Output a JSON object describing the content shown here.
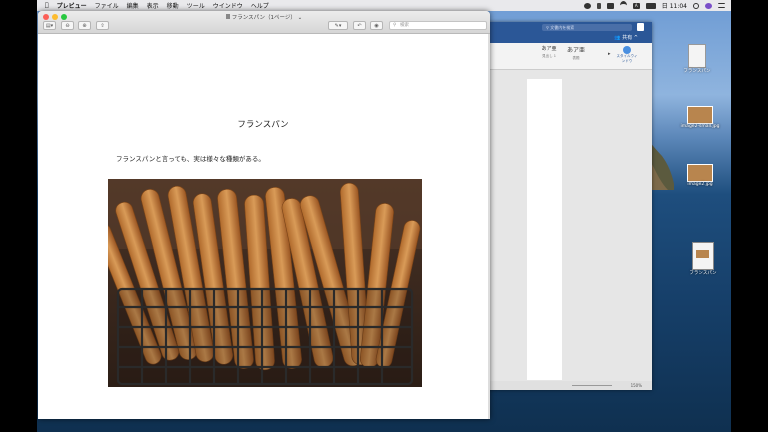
{
  "menubar": {
    "app_name": "プレビュー",
    "items": [
      "ファイル",
      "編集",
      "表示",
      "移動",
      "ツール",
      "ウインドウ",
      "ヘルプ"
    ],
    "clock": "日 11:04",
    "status_icons": [
      "record-icon",
      "bluetooth-icon",
      "airplay-icon",
      "wifi-icon",
      "input-method-icon",
      "battery-icon",
      "search-icon",
      "siri-icon",
      "menu-icon"
    ]
  },
  "preview": {
    "window_title": "フランスパン（1ページ）",
    "search_placeholder": "検索",
    "document": {
      "heading": "フランスパン",
      "body": "フランスパンと言っても、実は様々な種類がある。",
      "image_subject": "baguettes-in-wire-basket"
    }
  },
  "word": {
    "search_placeholder": "文書内を検索",
    "share_label": "共有",
    "styles": [
      {
        "sample": "あア亜",
        "name": "見出し 1"
      },
      {
        "sample": "あア亜",
        "name": "表題"
      }
    ],
    "styles_pane_label": "スタイルウィンドウ",
    "zoom": "150%"
  },
  "desktop": {
    "icons": [
      {
        "label": "フランスパン",
        "kind": "pdf"
      },
      {
        "label": "image2-small.jpg",
        "kind": "image"
      },
      {
        "label": "image2.jpg",
        "kind": "image"
      },
      {
        "label": "フランスパン",
        "kind": "preview-doc"
      }
    ]
  },
  "colors": {
    "word_blue": "#2b5797",
    "close": "#fc5f57",
    "minimize": "#fdbc2e",
    "zoom": "#28c840"
  }
}
